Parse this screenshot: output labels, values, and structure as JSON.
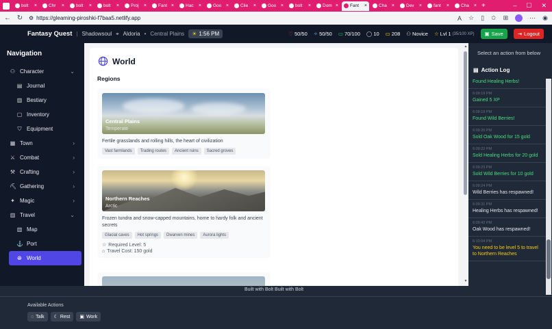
{
  "browser": {
    "tabs": [
      {
        "label": "bolt"
      },
      {
        "label": "Chr"
      },
      {
        "label": "bolt"
      },
      {
        "label": "bolt"
      },
      {
        "label": "Proj"
      },
      {
        "label": "Fant"
      },
      {
        "label": "Hac"
      },
      {
        "label": "Goo"
      },
      {
        "label": "Clie"
      },
      {
        "label": "Goo"
      },
      {
        "label": "bolt"
      },
      {
        "label": "Dom"
      },
      {
        "label": "Fant",
        "active": true
      },
      {
        "label": "Cha"
      },
      {
        "label": "Dev"
      },
      {
        "label": "fant"
      },
      {
        "label": "Cha"
      }
    ],
    "url": "https://gleaming-piroshki-f7baa5.netlify.app"
  },
  "header": {
    "game_title": "Fantasy Quest",
    "character_name": "Shadowsoul",
    "kingdom": "Aldoria",
    "location": "Central Plains",
    "time": "1:56 PM",
    "health": "50/50",
    "mana": "50/50",
    "stamina": "70/100",
    "stat_ten": "10",
    "gold": "208",
    "rank": "Novice",
    "level": "Lvl 1",
    "xp": "(35/100 XP)",
    "save_label": "Save",
    "logout_label": "Logout"
  },
  "sidebar": {
    "title": "Navigation",
    "character_label": "Character",
    "character_sub": [
      "Journal",
      "Bestiary",
      "Inventory",
      "Equipment"
    ],
    "town_label": "Town",
    "combat_label": "Combat",
    "crafting_label": "Crafting",
    "gathering_label": "Gathering",
    "magic_label": "Magic",
    "travel_label": "Travel",
    "travel_sub": [
      "Map",
      "Port",
      "World"
    ]
  },
  "main": {
    "page_title": "World",
    "regions_label": "Regions",
    "regions": [
      {
        "name": "Central Plains",
        "climate": "Temperate",
        "description": "Fertile grasslands and rolling hills, the heart of civilization",
        "tags": [
          "Vast farmlands",
          "Trading routes",
          "Ancient ruins",
          "Sacred groves"
        ]
      },
      {
        "name": "Northern Reaches",
        "climate": "Arctic",
        "description": "Frozen tundra and snow-capped mountains, home to hardy folk and ancient secrets",
        "tags": [
          "Glacial caves",
          "Hot springs",
          "Dwarven mines",
          "Aurora lights"
        ],
        "required_level": "Required Level: 5",
        "travel_cost": "Travel Cost: 150 gold"
      }
    ]
  },
  "right_panel": {
    "action_hint": "Select an action from below",
    "log_title": "Action Log",
    "log": [
      {
        "time": "",
        "msg": "Found Healing Herbs!",
        "color": "green"
      },
      {
        "time": "6:09:19 PM",
        "msg": "Gained 5 XP",
        "color": "green"
      },
      {
        "time": "6:09:19 PM",
        "msg": "Found Wild Berries!",
        "color": "green"
      },
      {
        "time": "6:09:20 PM",
        "msg": "Sold Oak Wood for 15 gold",
        "color": "green"
      },
      {
        "time": "6:09:22 PM",
        "msg": "Sold Healing Herbs for 20 gold",
        "color": "green"
      },
      {
        "time": "6:09:23 PM",
        "msg": "Sold Wild Berries for 10 gold",
        "color": "green"
      },
      {
        "time": "6:09:24 PM",
        "msg": "Wild Berries has respawned!",
        "color": "white"
      },
      {
        "time": "6:09:31 PM",
        "msg": "Healing Herbs has respawned!",
        "color": "white"
      },
      {
        "time": "6:09:42 PM",
        "msg": "Oak Wood has respawned!",
        "color": "white"
      },
      {
        "time": "6:10:04 PM",
        "msg": "You need to be level 5 to travel to Northern Reaches",
        "color": "yellow"
      }
    ]
  },
  "footer": {
    "bolt_alt": "Built with Bolt",
    "bolt_label": "Built with Bolt"
  },
  "bottom": {
    "available_actions_label": "Available Actions",
    "talk_label": "Talk",
    "rest_label": "Rest",
    "work_label": "Work"
  }
}
